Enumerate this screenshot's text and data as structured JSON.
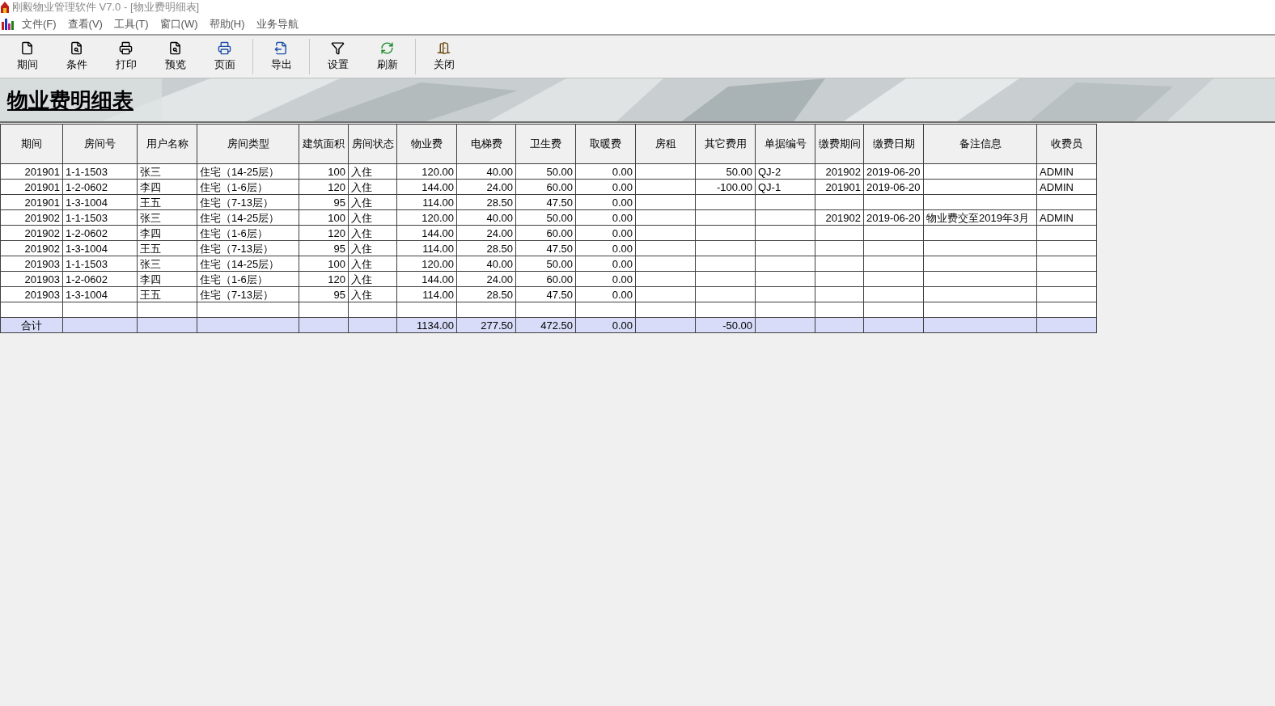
{
  "window": {
    "title": "刚毅物业管理软件 V7.0 - [物业费明细表]"
  },
  "menu": [
    "文件(F)",
    "查看(V)",
    "工具(T)",
    "窗口(W)",
    "帮助(H)",
    "业务导航"
  ],
  "toolbar": [
    {
      "kind": "period",
      "label": "期间"
    },
    {
      "kind": "condition",
      "label": "条件"
    },
    {
      "kind": "print",
      "label": "打印"
    },
    {
      "kind": "preview",
      "label": "预览"
    },
    {
      "kind": "page",
      "label": "页面"
    },
    {
      "kind": "export",
      "label": "导出"
    },
    {
      "kind": "settings",
      "label": "设置"
    },
    {
      "kind": "refresh",
      "label": "刷新"
    },
    {
      "kind": "close",
      "label": "关闭"
    }
  ],
  "report": {
    "title": "物业费明细表"
  },
  "table": {
    "columns": [
      "期间",
      "房间号",
      "用户名称",
      "房间类型",
      "建筑面积",
      "房间状态",
      "物业费",
      "电梯费",
      "卫生费",
      "取暖费",
      "房租",
      "其它费用",
      "单据编号",
      "缴费期间",
      "缴费日期",
      "备注信息",
      "收费员"
    ],
    "rows": [
      {
        "period": "201901",
        "room": "1-1-1503",
        "user": "张三",
        "room_type": "住宅（14-25层）",
        "area": "100",
        "status": "入住",
        "property_fee": "120.00",
        "elevator_fee": "40.00",
        "sanitation_fee": "50.00",
        "heating_fee": "0.00",
        "other_fees": "50.00",
        "receipt_no": "QJ-2",
        "pay_period": "201902",
        "pay_date": "2019-06-20",
        "collector": "ADMIN"
      },
      {
        "period": "201901",
        "room": "1-2-0602",
        "user": "李四",
        "room_type": "住宅（1-6层）",
        "area": "120",
        "status": "入住",
        "property_fee": "144.00",
        "elevator_fee": "24.00",
        "sanitation_fee": "60.00",
        "heating_fee": "0.00",
        "other_fees": "-100.00",
        "receipt_no": "QJ-1",
        "pay_period": "201901",
        "pay_date": "2019-06-20",
        "collector": "ADMIN"
      },
      {
        "period": "201901",
        "room": "1-3-1004",
        "user": "王五",
        "room_type": "住宅（7-13层）",
        "area": "95",
        "status": "入住",
        "property_fee": "114.00",
        "elevator_fee": "28.50",
        "sanitation_fee": "47.50",
        "heating_fee": "0.00"
      },
      {
        "period": "201902",
        "room": "1-1-1503",
        "user": "张三",
        "room_type": "住宅（14-25层）",
        "area": "100",
        "status": "入住",
        "property_fee": "120.00",
        "elevator_fee": "40.00",
        "sanitation_fee": "50.00",
        "heating_fee": "0.00",
        "pay_period": "201902",
        "pay_date": "2019-06-20",
        "note": "物业费交至2019年3月",
        "collector": "ADMIN"
      },
      {
        "period": "201902",
        "room": "1-2-0602",
        "user": "李四",
        "room_type": "住宅（1-6层）",
        "area": "120",
        "status": "入住",
        "property_fee": "144.00",
        "elevator_fee": "24.00",
        "sanitation_fee": "60.00",
        "heating_fee": "0.00"
      },
      {
        "period": "201902",
        "room": "1-3-1004",
        "user": "王五",
        "room_type": "住宅（7-13层）",
        "area": "95",
        "status": "入住",
        "property_fee": "114.00",
        "elevator_fee": "28.50",
        "sanitation_fee": "47.50",
        "heating_fee": "0.00"
      },
      {
        "period": "201903",
        "room": "1-1-1503",
        "user": "张三",
        "room_type": "住宅（14-25层）",
        "area": "100",
        "status": "入住",
        "property_fee": "120.00",
        "elevator_fee": "40.00",
        "sanitation_fee": "50.00",
        "heating_fee": "0.00"
      },
      {
        "period": "201903",
        "room": "1-2-0602",
        "user": "李四",
        "room_type": "住宅（1-6层）",
        "area": "120",
        "status": "入住",
        "property_fee": "144.00",
        "elevator_fee": "24.00",
        "sanitation_fee": "60.00",
        "heating_fee": "0.00"
      },
      {
        "period": "201903",
        "room": "1-3-1004",
        "user": "王五",
        "room_type": "住宅（7-13层）",
        "area": "95",
        "status": "入住",
        "property_fee": "114.00",
        "elevator_fee": "28.50",
        "sanitation_fee": "47.50",
        "heating_fee": "0.00"
      }
    ],
    "total": {
      "period": "合计",
      "property_fee": "1134.00",
      "elevator_fee": "277.50",
      "sanitation_fee": "472.50",
      "heating_fee": "0.00",
      "other_fees": "-50.00"
    }
  }
}
